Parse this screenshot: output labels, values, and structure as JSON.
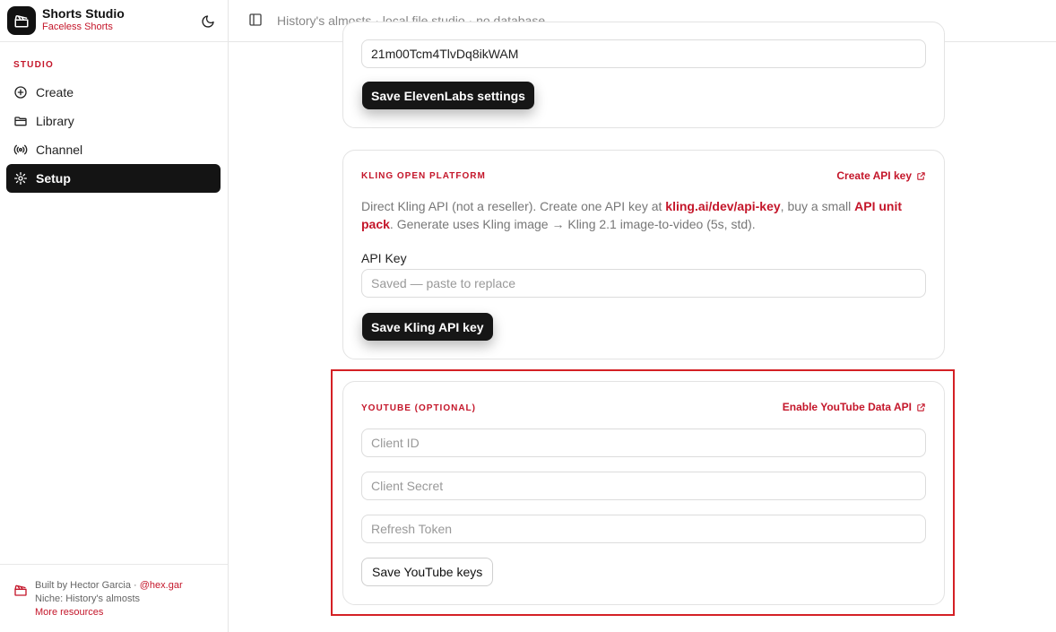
{
  "app": {
    "title": "Shorts Studio",
    "subtitle": "Faceless Shorts",
    "accent_color": "#c4162a"
  },
  "header": {
    "breadcrumb": "History's almosts · local file studio · no database"
  },
  "sidebar": {
    "section_label": "STUDIO",
    "items": [
      {
        "label": "Create",
        "icon": "plus-circle-icon"
      },
      {
        "label": "Library",
        "icon": "folder-icon"
      },
      {
        "label": "Channel",
        "icon": "broadcast-icon"
      },
      {
        "label": "Setup",
        "icon": "gear-icon",
        "active": true
      }
    ],
    "footer": {
      "built_by": "Built by Hector Garcia · ",
      "handle": "@hex.gar",
      "niche": "Niche: History's almosts",
      "more": "More resources"
    }
  },
  "elevenlabs": {
    "voice_id_value": "21m00Tcm4TlvDq8ikWAM",
    "save_label": "Save ElevenLabs settings"
  },
  "kling": {
    "heading": "KLING OPEN PLATFORM",
    "link_label": "Create API key",
    "desc_part1": "Direct Kling API (not a reseller). Create one API key at ",
    "desc_link1": "kling.ai/dev/api-key",
    "desc_part2": ", buy a small ",
    "desc_link2": "API unit pack",
    "desc_part3": ". Generate uses Kling image → Kling 2.1 image-to-video (5s, std).",
    "api_key_label": "API Key",
    "api_key_placeholder": "Saved — paste to replace",
    "save_label": "Save Kling API key"
  },
  "youtube": {
    "heading": "YOUTUBE (OPTIONAL)",
    "link_label": "Enable YouTube Data API",
    "client_id_placeholder": "Client ID",
    "client_secret_placeholder": "Client Secret",
    "refresh_token_placeholder": "Refresh Token",
    "save_label": "Save YouTube keys"
  }
}
